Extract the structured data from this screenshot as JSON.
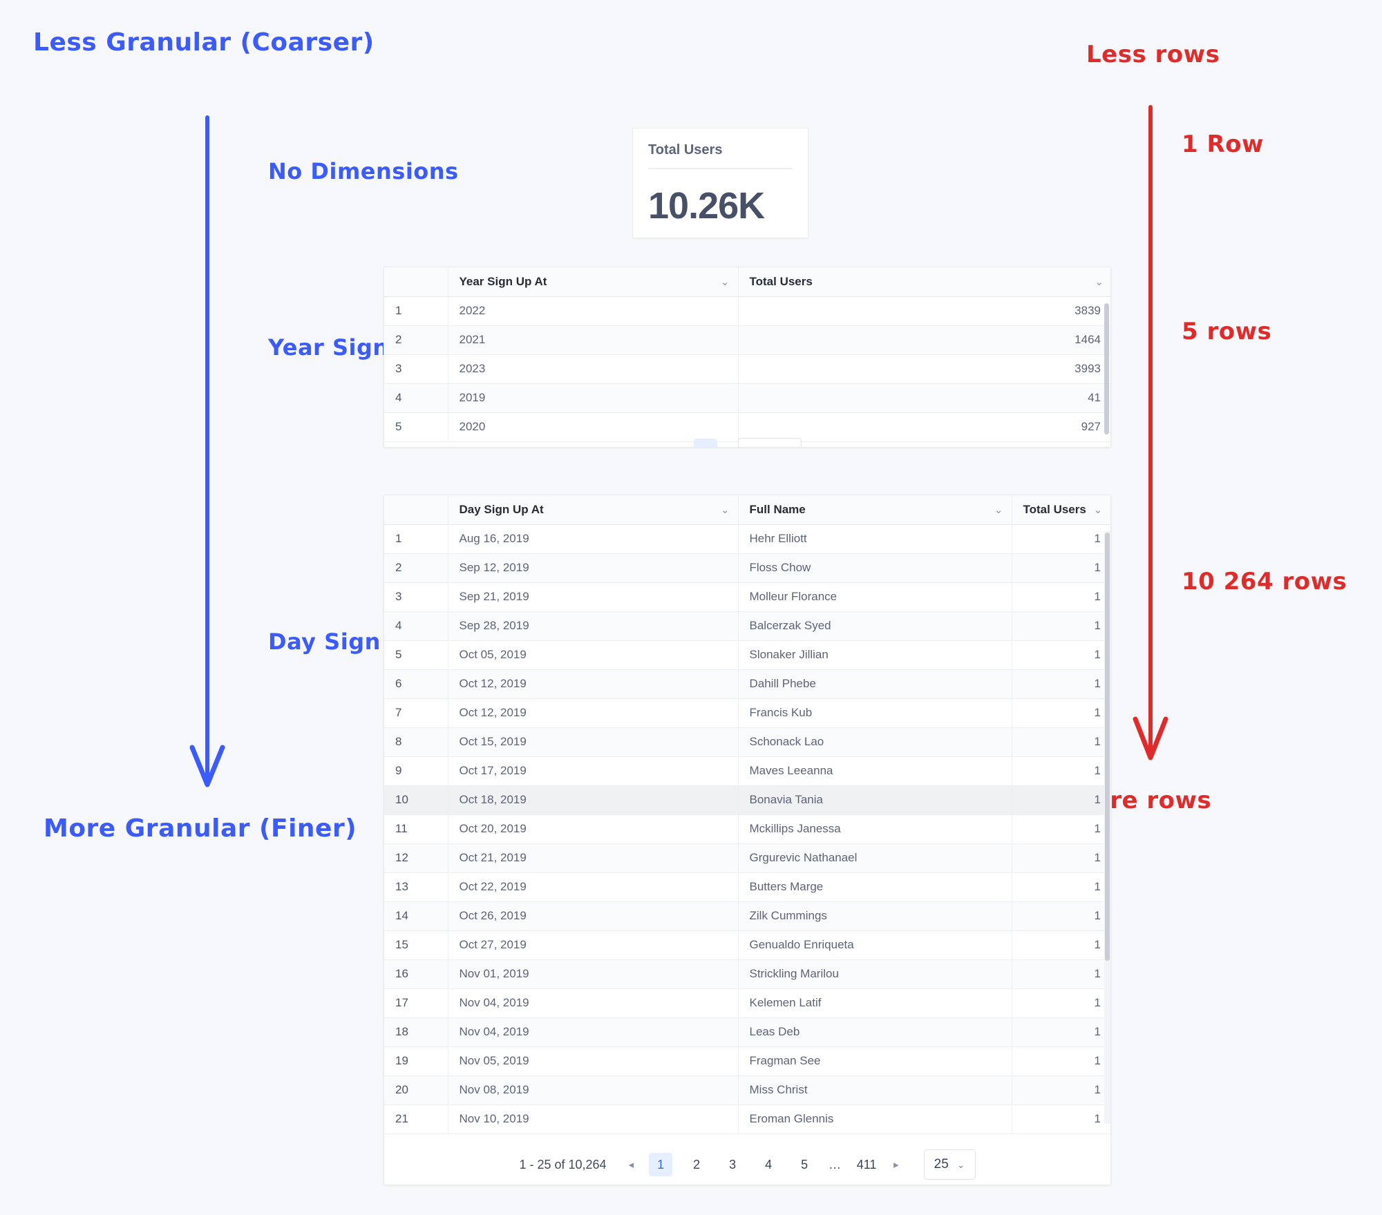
{
  "colors": {
    "blue": "#3b5bfd",
    "red": "#e02b2b",
    "background": "#f7f8fb",
    "accent": "#2f6fd0"
  },
  "annotations": {
    "top_left": "Less Granular (Coarser)",
    "bottom_left": "More Granular (Finer)",
    "top_right": "Less rows",
    "bottom_right": "More rows",
    "level_1_dimension": "No Dimensions",
    "level_2_dimension": "Year Sign Up At",
    "level_3_dimension": "Day Sign Up At + Name",
    "level_1_rows": "1 Row",
    "level_2_rows": "5 rows",
    "level_3_rows": "10 264 rows"
  },
  "kpi": {
    "title": "Total Users",
    "value": "10.26K"
  },
  "year_table": {
    "columns": [
      "",
      "Year Sign Up At",
      "Total Users"
    ],
    "rows": [
      {
        "index": "1",
        "year": "2022",
        "total_users": "3839"
      },
      {
        "index": "2",
        "year": "2021",
        "total_users": "1464"
      },
      {
        "index": "3",
        "year": "2023",
        "total_users": "3993"
      },
      {
        "index": "4",
        "year": "2019",
        "total_users": "41"
      },
      {
        "index": "5",
        "year": "2020",
        "total_users": "927"
      }
    ]
  },
  "day_table": {
    "columns": [
      "",
      "Day Sign Up At",
      "Full Name",
      "Total Users"
    ],
    "rows": [
      {
        "index": "1",
        "day": "Aug 16, 2019",
        "name": "Hehr Elliott",
        "total_users": "1"
      },
      {
        "index": "2",
        "day": "Sep 12, 2019",
        "name": "Floss Chow",
        "total_users": "1"
      },
      {
        "index": "3",
        "day": "Sep 21, 2019",
        "name": "Molleur Florance",
        "total_users": "1"
      },
      {
        "index": "4",
        "day": "Sep 28, 2019",
        "name": "Balcerzak Syed",
        "total_users": "1"
      },
      {
        "index": "5",
        "day": "Oct 05, 2019",
        "name": "Slonaker Jillian",
        "total_users": "1"
      },
      {
        "index": "6",
        "day": "Oct 12, 2019",
        "name": "Dahill Phebe",
        "total_users": "1"
      },
      {
        "index": "7",
        "day": "Oct 12, 2019",
        "name": "Francis Kub",
        "total_users": "1"
      },
      {
        "index": "8",
        "day": "Oct 15, 2019",
        "name": "Schonack Lao",
        "total_users": "1"
      },
      {
        "index": "9",
        "day": "Oct 17, 2019",
        "name": "Maves Leeanna",
        "total_users": "1"
      },
      {
        "index": "10",
        "day": "Oct 18, 2019",
        "name": "Bonavia Tania",
        "total_users": "1"
      },
      {
        "index": "11",
        "day": "Oct 20, 2019",
        "name": "Mckillips Janessa",
        "total_users": "1"
      },
      {
        "index": "12",
        "day": "Oct 21, 2019",
        "name": "Grgurevic Nathanael",
        "total_users": "1"
      },
      {
        "index": "13",
        "day": "Oct 22, 2019",
        "name": "Butters Marge",
        "total_users": "1"
      },
      {
        "index": "14",
        "day": "Oct 26, 2019",
        "name": "Zilk Cummings",
        "total_users": "1"
      },
      {
        "index": "15",
        "day": "Oct 27, 2019",
        "name": "Genualdo Enriqueta",
        "total_users": "1"
      },
      {
        "index": "16",
        "day": "Nov 01, 2019",
        "name": "Strickling Marilou",
        "total_users": "1"
      },
      {
        "index": "17",
        "day": "Nov 04, 2019",
        "name": "Kelemen Latif",
        "total_users": "1"
      },
      {
        "index": "18",
        "day": "Nov 04, 2019",
        "name": "Leas Deb",
        "total_users": "1"
      },
      {
        "index": "19",
        "day": "Nov 05, 2019",
        "name": "Fragman See",
        "total_users": "1"
      },
      {
        "index": "20",
        "day": "Nov 08, 2019",
        "name": "Miss Christ",
        "total_users": "1"
      },
      {
        "index": "21",
        "day": "Nov 10, 2019",
        "name": "Eroman Glennis",
        "total_users": "1"
      }
    ],
    "hovered_row_index": "10"
  },
  "pagination": {
    "info": "1 - 25 of 10,264",
    "prev_icon": "◂",
    "next_icon": "▸",
    "pages": [
      "1",
      "2",
      "3",
      "4",
      "5",
      "…",
      "411"
    ],
    "active_page": "1",
    "page_size": "25",
    "chevron_icon": "⌄"
  },
  "icons": {
    "column_chevron": "⌄"
  }
}
